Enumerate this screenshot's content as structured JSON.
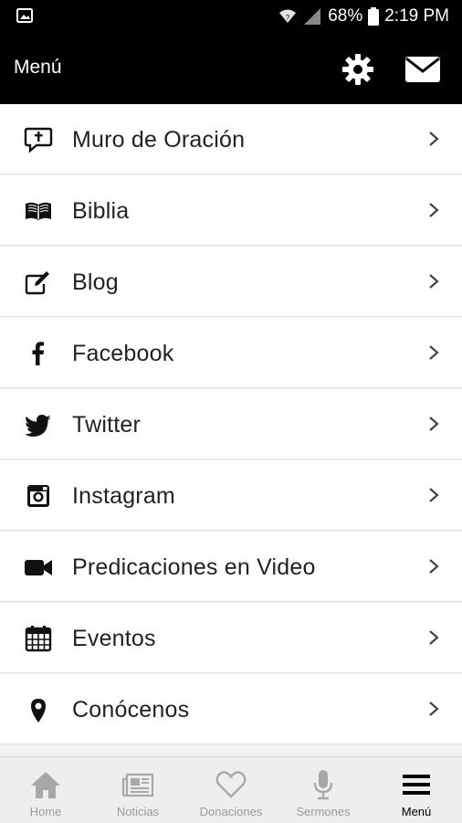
{
  "status_bar": {
    "battery": "68%",
    "time": "2:19 PM"
  },
  "app_bar": {
    "title": "Menú"
  },
  "menu": [
    {
      "label": "Muro de Oración",
      "icon": "prayer-wall-icon"
    },
    {
      "label": "Biblia",
      "icon": "book-icon"
    },
    {
      "label": "Blog",
      "icon": "edit-icon"
    },
    {
      "label": "Facebook",
      "icon": "facebook-icon"
    },
    {
      "label": "Twitter",
      "icon": "twitter-icon"
    },
    {
      "label": "Instagram",
      "icon": "instagram-icon"
    },
    {
      "label": "Predicaciones en Video",
      "icon": "video-camera-icon"
    },
    {
      "label": "Eventos",
      "icon": "calendar-icon"
    },
    {
      "label": "Conócenos",
      "icon": "map-marker-icon"
    }
  ],
  "bottom_nav": [
    {
      "label": "Home",
      "icon": "home-icon"
    },
    {
      "label": "Noticias",
      "icon": "newspaper-icon"
    },
    {
      "label": "Donaciones",
      "icon": "heart-icon"
    },
    {
      "label": "Sermones",
      "icon": "microphone-icon"
    },
    {
      "label": "Menú",
      "icon": "hamburger-menu-icon",
      "active": true
    }
  ]
}
